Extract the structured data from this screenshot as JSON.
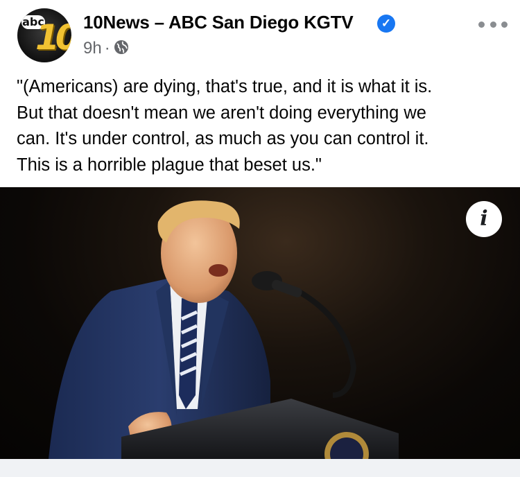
{
  "post": {
    "page_name": "10News – ABC San Diego KGTV",
    "avatar": {
      "abc_text": "abc",
      "number_text": "10"
    },
    "verified_icon": "check-mark",
    "time": "9h",
    "separator": "·",
    "audience_icon": "globe-icon",
    "more_icon": "three-dots-icon",
    "text": "\"(Americans) are dying, that's true, and it is what it is.\nBut that doesn't mean we aren't doing everything we\ncan. It's under control, as much as you can control it.\nThis is a horrible plague that beset us.\"",
    "photo_info_icon": "i"
  }
}
